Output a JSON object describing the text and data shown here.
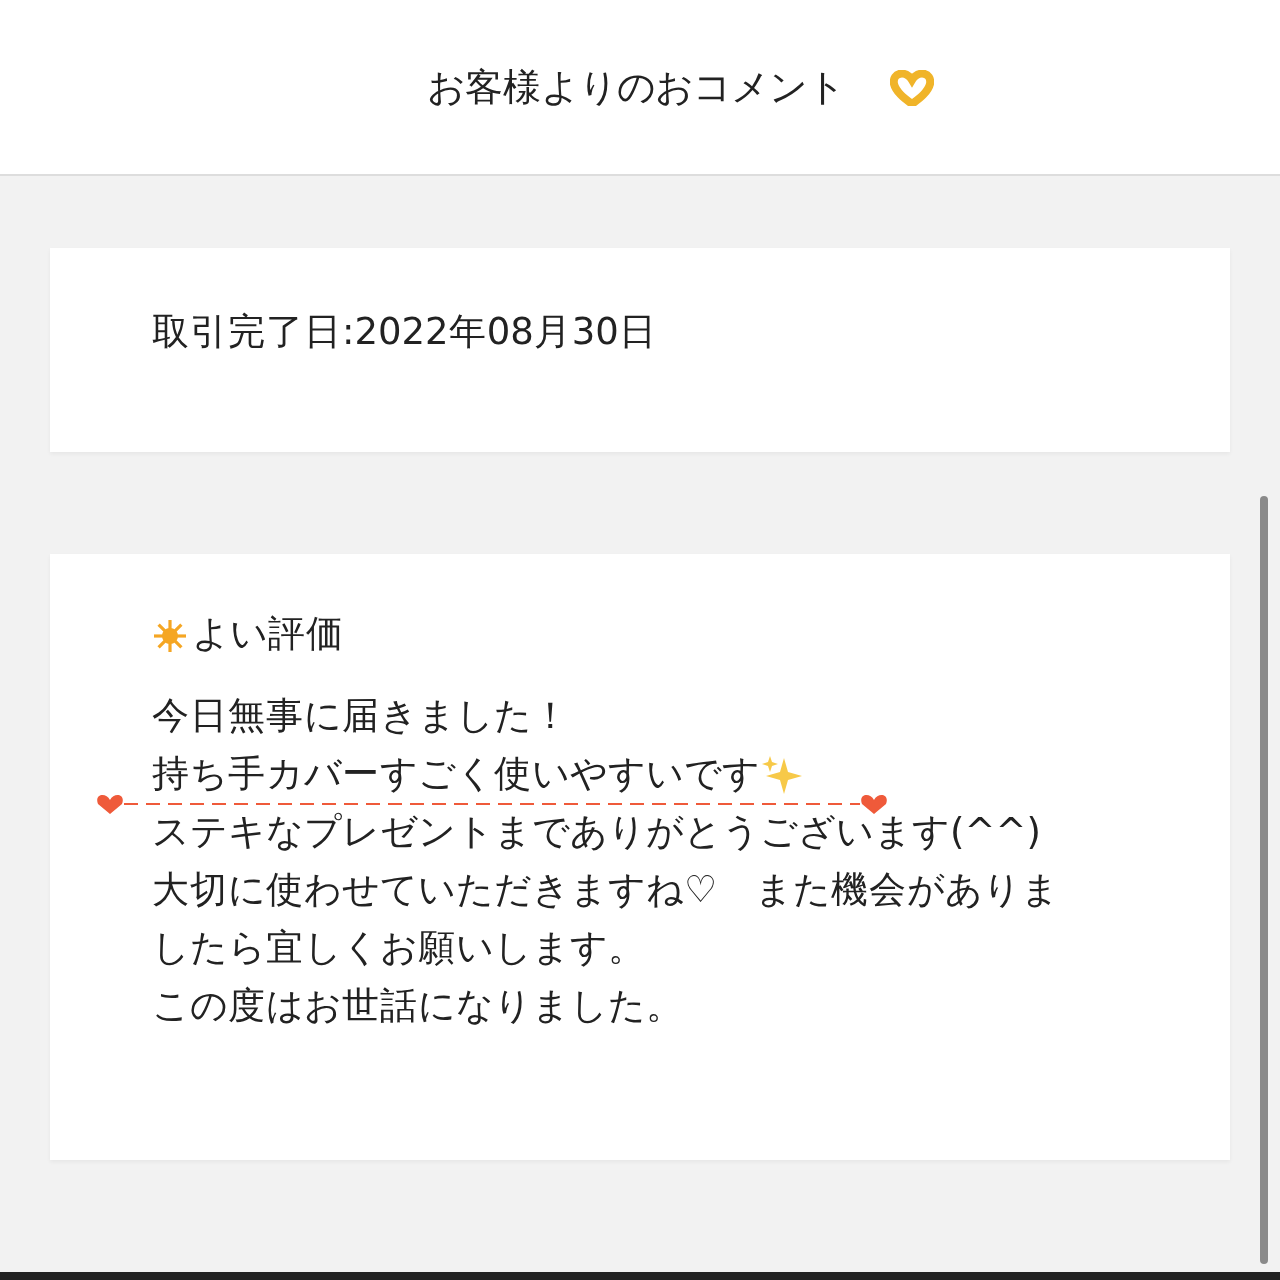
{
  "header": {
    "title": "お客様よりのおコメント"
  },
  "transaction": {
    "date_text": "取引完了日:2022年08月30日"
  },
  "review": {
    "rating_label": "よい評価",
    "lines": [
      "今日無事に届きました！",
      "持ち手カバーすごく使いやすいです",
      "ステキなプレゼントまでありがとうございます(^^)",
      "大切に使わせていただきますね♡　また機会がありま",
      "したら宜しくお願いします。",
      "この度はお世話になりました。"
    ]
  }
}
